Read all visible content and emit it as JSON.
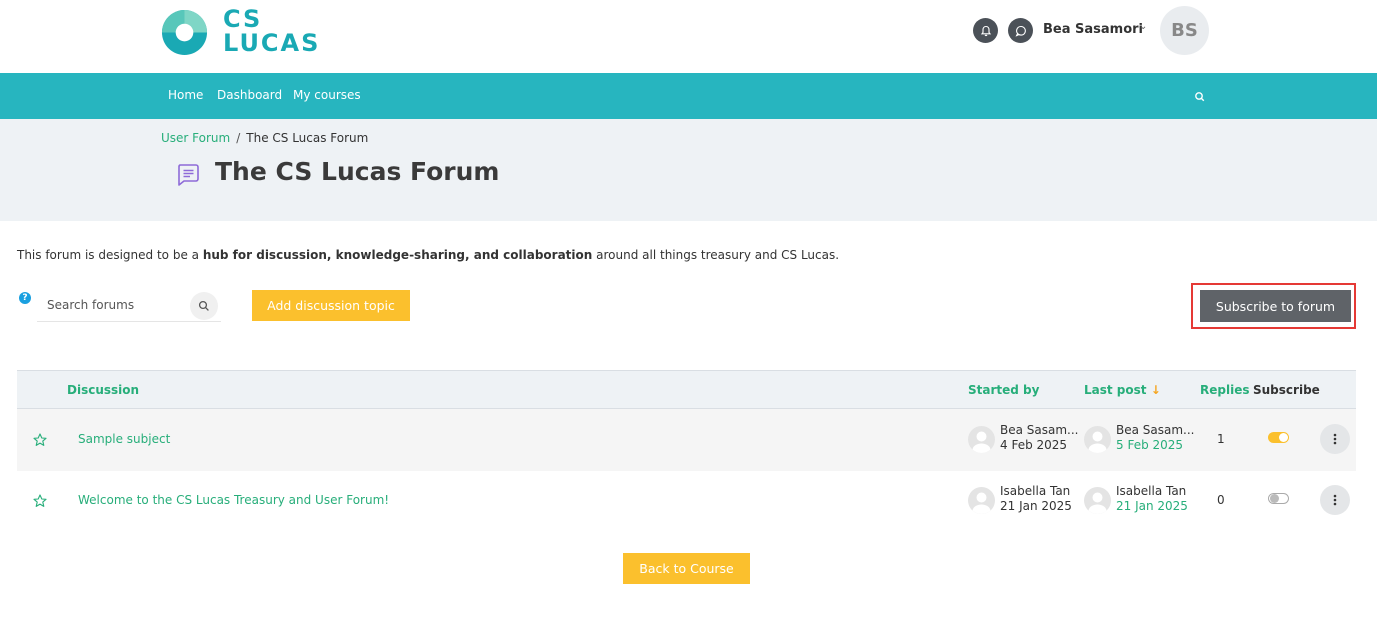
{
  "header": {
    "logo_line1": "CS",
    "logo_line2": "LUCAS",
    "user_name": "Bea Sasamori",
    "user_initials": "BS",
    "brand_color": "#27b5bf"
  },
  "nav": {
    "items": [
      "Home",
      "Dashboard",
      "My courses"
    ]
  },
  "breadcrumb": {
    "parent": "User Forum",
    "current": "The CS Lucas Forum"
  },
  "page": {
    "title": "The CS Lucas Forum",
    "intro_prefix": "This forum is designed to be a ",
    "intro_bold": "hub for discussion, knowledge-sharing, and collaboration",
    "intro_suffix": " around all things treasury and CS Lucas."
  },
  "controls": {
    "search_placeholder": "Search forums",
    "add_label": "Add discussion topic",
    "subscribe_label": "Subscribe to forum",
    "back_label": "Back to Course"
  },
  "table": {
    "headers": {
      "discussion": "Discussion",
      "started_by": "Started by",
      "last_post": "Last post",
      "replies": "Replies",
      "subscribe": "Subscribe"
    },
    "rows": [
      {
        "subject": "Sample subject",
        "starter_name": "Bea Sasam...",
        "starter_date": "4 Feb 2025",
        "last_name": "Bea Sasam...",
        "last_date": "5 Feb 2025",
        "replies": "1",
        "subscribed": true
      },
      {
        "subject": "Welcome to the CS Lucas Treasury and User Forum!",
        "starter_name": "Isabella Tan",
        "starter_date": "21 Jan 2025",
        "last_name": "Isabella Tan",
        "last_date": "21 Jan 2025",
        "replies": "0",
        "subscribed": false
      }
    ]
  }
}
